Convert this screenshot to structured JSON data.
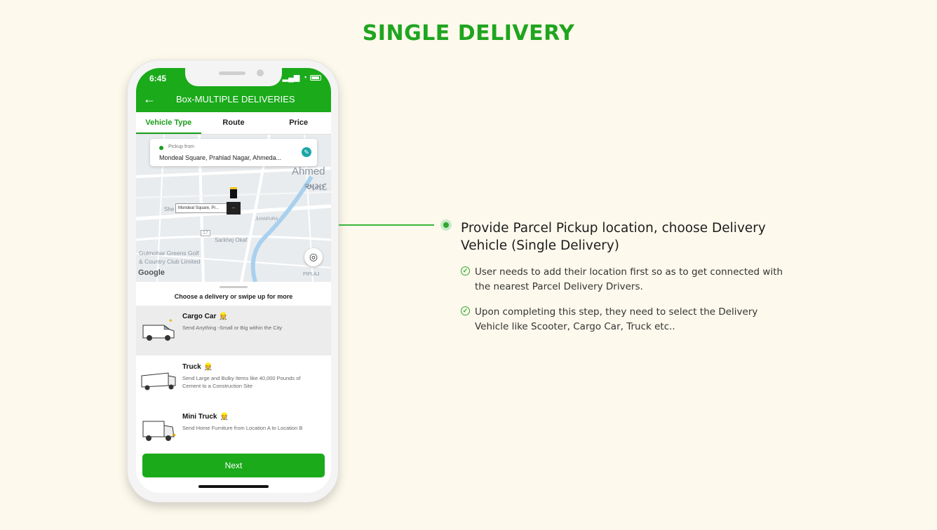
{
  "page": {
    "title": "SINGLE DELIVERY"
  },
  "phone": {
    "status": {
      "time": "6:45"
    },
    "appbar": {
      "back_icon": "arrow-left-icon",
      "title": "Box-MULTIPLE DELIVERIES"
    },
    "tabs": [
      {
        "label": "Vehicle Type",
        "active": true
      },
      {
        "label": "Route",
        "active": false
      },
      {
        "label": "Price",
        "active": false
      }
    ],
    "map": {
      "pickup_label": "Pickup from",
      "pickup_address": "Mondeal Square, Prahlad Nagar, Ahmeda...",
      "pin_label": "Mondeal Square, Pr...",
      "pin_suffix": "...",
      "labels": [
        "Ahmed",
        "અમદ",
        "She",
        "Sarkhej Okaf",
        "JUHAPURA",
        "Gulmohar Greens Golf",
        "& Country Club Limited",
        "PIPLAJ",
        "17"
      ],
      "google_logo": "Google"
    },
    "sheet": {
      "heading": "Choose a delivery or swipe up for more",
      "vehicles": [
        {
          "name": "Cargo Car",
          "badge": "👷",
          "description": "Send Anything -Small or Big within the City",
          "selected": true
        },
        {
          "name": "Truck",
          "badge": "👷",
          "description": "Send Large and Bulky Items like 40,000 Pounds of Cement to a Construction Site",
          "selected": false
        },
        {
          "name": "Mini Truck",
          "badge": "👷",
          "description": "Send Home Furniture from Location A to Location B",
          "selected": false
        }
      ],
      "next_label": "Next"
    }
  },
  "callout": {
    "title": "Provide Parcel Pickup location, choose Delivery Vehicle (Single Delivery)",
    "points": [
      "User needs to add their location first so as to get connected with the nearest Parcel Delivery Drivers.",
      "Upon completing this step, they need to select the Delivery Vehicle like Scooter, Cargo Car, Truck etc.."
    ]
  },
  "colors": {
    "brand_green": "#1aaa1a",
    "title_green": "#1fa51f",
    "background": "#fdf9ec"
  }
}
